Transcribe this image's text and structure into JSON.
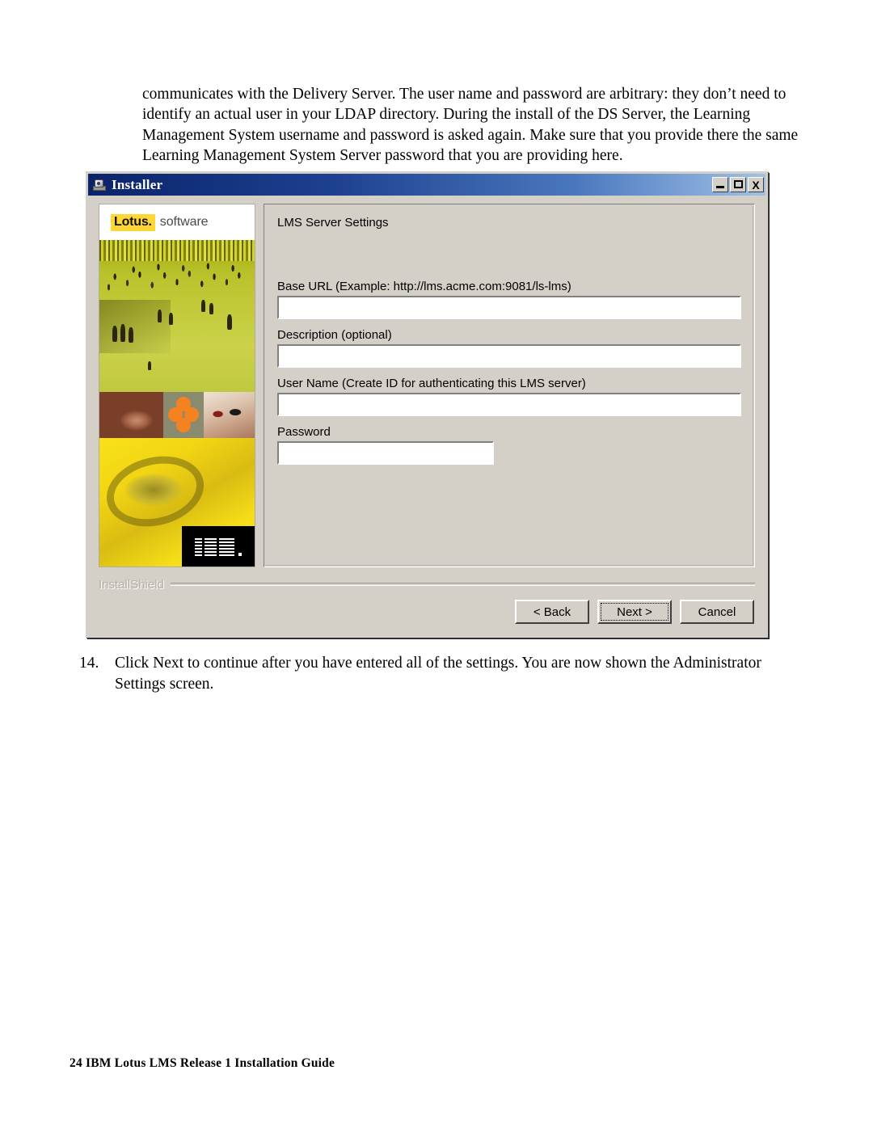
{
  "document": {
    "intro_paragraph": "communicates with the Delivery Server. The user name and password are arbitrary: they don’t need to identify an actual user in your LDAP directory. During the install of the DS Server, the Learning Management System username and password is asked again. Make sure that you provide there the same Learning Management System Server password that you are providing here.",
    "step": {
      "number": "14.",
      "text": "Click Next to continue after you have entered all of the settings. You are now shown the Administrator Settings screen."
    },
    "footer": "24 IBM Lotus LMS Release 1 Installation Guide"
  },
  "installer": {
    "title": "Installer",
    "window_controls": {
      "minimize": "–",
      "maximize": "□",
      "close": "X"
    },
    "sidebar": {
      "brand_mark": "Lotus.",
      "brand_suffix": "software",
      "logo_text": "IBM"
    },
    "panel": {
      "heading": "LMS Server Settings",
      "fields": [
        {
          "id": "base-url",
          "label": "Base URL (Example: http://lms.acme.com:9081/ls-lms)",
          "value": "",
          "placeholder": ""
        },
        {
          "id": "description",
          "label": "Description (optional)",
          "value": "",
          "placeholder": ""
        },
        {
          "id": "user-name",
          "label": "User Name (Create ID for authenticating this LMS server)",
          "value": "",
          "placeholder": ""
        },
        {
          "id": "password",
          "label": "Password",
          "value": "",
          "placeholder": ""
        }
      ]
    },
    "installshield_label": "InstallShield",
    "buttons": {
      "back": "< Back",
      "next": "Next >",
      "cancel": "Cancel"
    },
    "colors": {
      "titlebar_start": "#0a246a",
      "titlebar_end": "#9fc1e8",
      "dialog_face": "#d4d0c8",
      "lotus_yellow": "#ffd633",
      "lotus_orange": "#f58220"
    }
  }
}
